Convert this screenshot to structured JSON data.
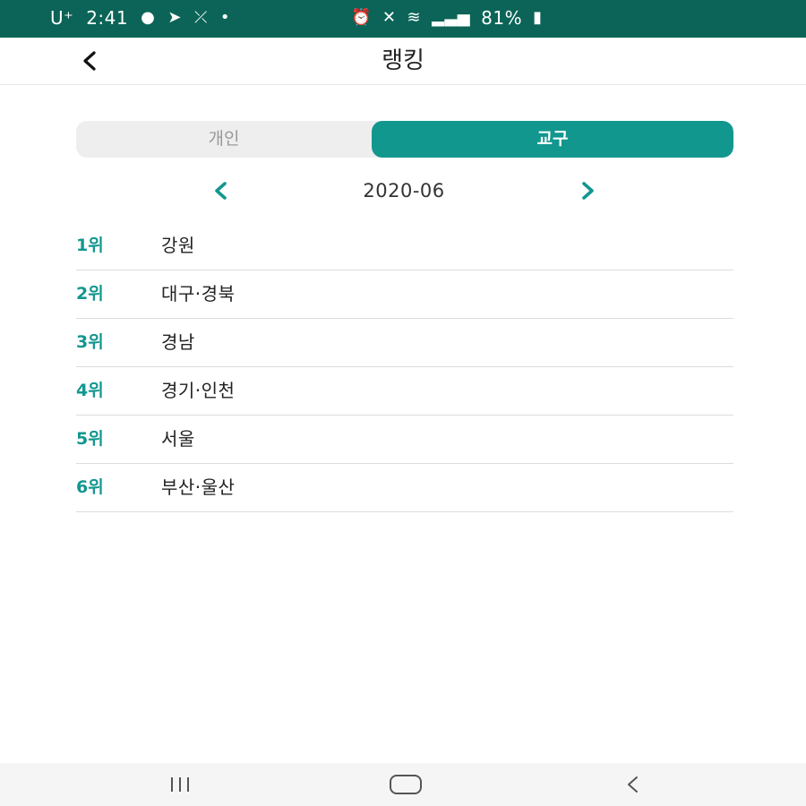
{
  "status_bar": {
    "carrier": "U⁺",
    "time": "2:41",
    "left_icons": [
      "chrome-icon",
      "telegram-icon",
      "missed-call-icon",
      "dot-icon"
    ],
    "right_icons": [
      "alarm-icon",
      "mute-icon",
      "wifi-icon",
      "signal-icon"
    ],
    "battery": "81%"
  },
  "header": {
    "back_icon": "back-chevron-icon",
    "title": "랭킹"
  },
  "tabs": [
    {
      "label": "개인",
      "selected": false
    },
    {
      "label": "교구",
      "selected": true
    }
  ],
  "month_nav": {
    "label": "2020-06",
    "prev_icon": "chevron-left-icon",
    "next_icon": "chevron-right-icon"
  },
  "rankings": [
    {
      "rank": "1위",
      "name": "강원"
    },
    {
      "rank": "2위",
      "name": "대구·경북"
    },
    {
      "rank": "3위",
      "name": "경남"
    },
    {
      "rank": "4위",
      "name": "경기·인천"
    },
    {
      "rank": "5위",
      "name": "서울"
    },
    {
      "rank": "6위",
      "name": "부산·울산"
    }
  ],
  "nav_bar": {
    "recent_icon": "recent-apps-icon",
    "home_icon": "home-icon",
    "back_icon": "nav-back-icon"
  },
  "colors": {
    "status_bar": "#0b6457",
    "accent": "#12978f",
    "tab_bg": "#eeeeee",
    "divider": "#dcdcdc"
  }
}
